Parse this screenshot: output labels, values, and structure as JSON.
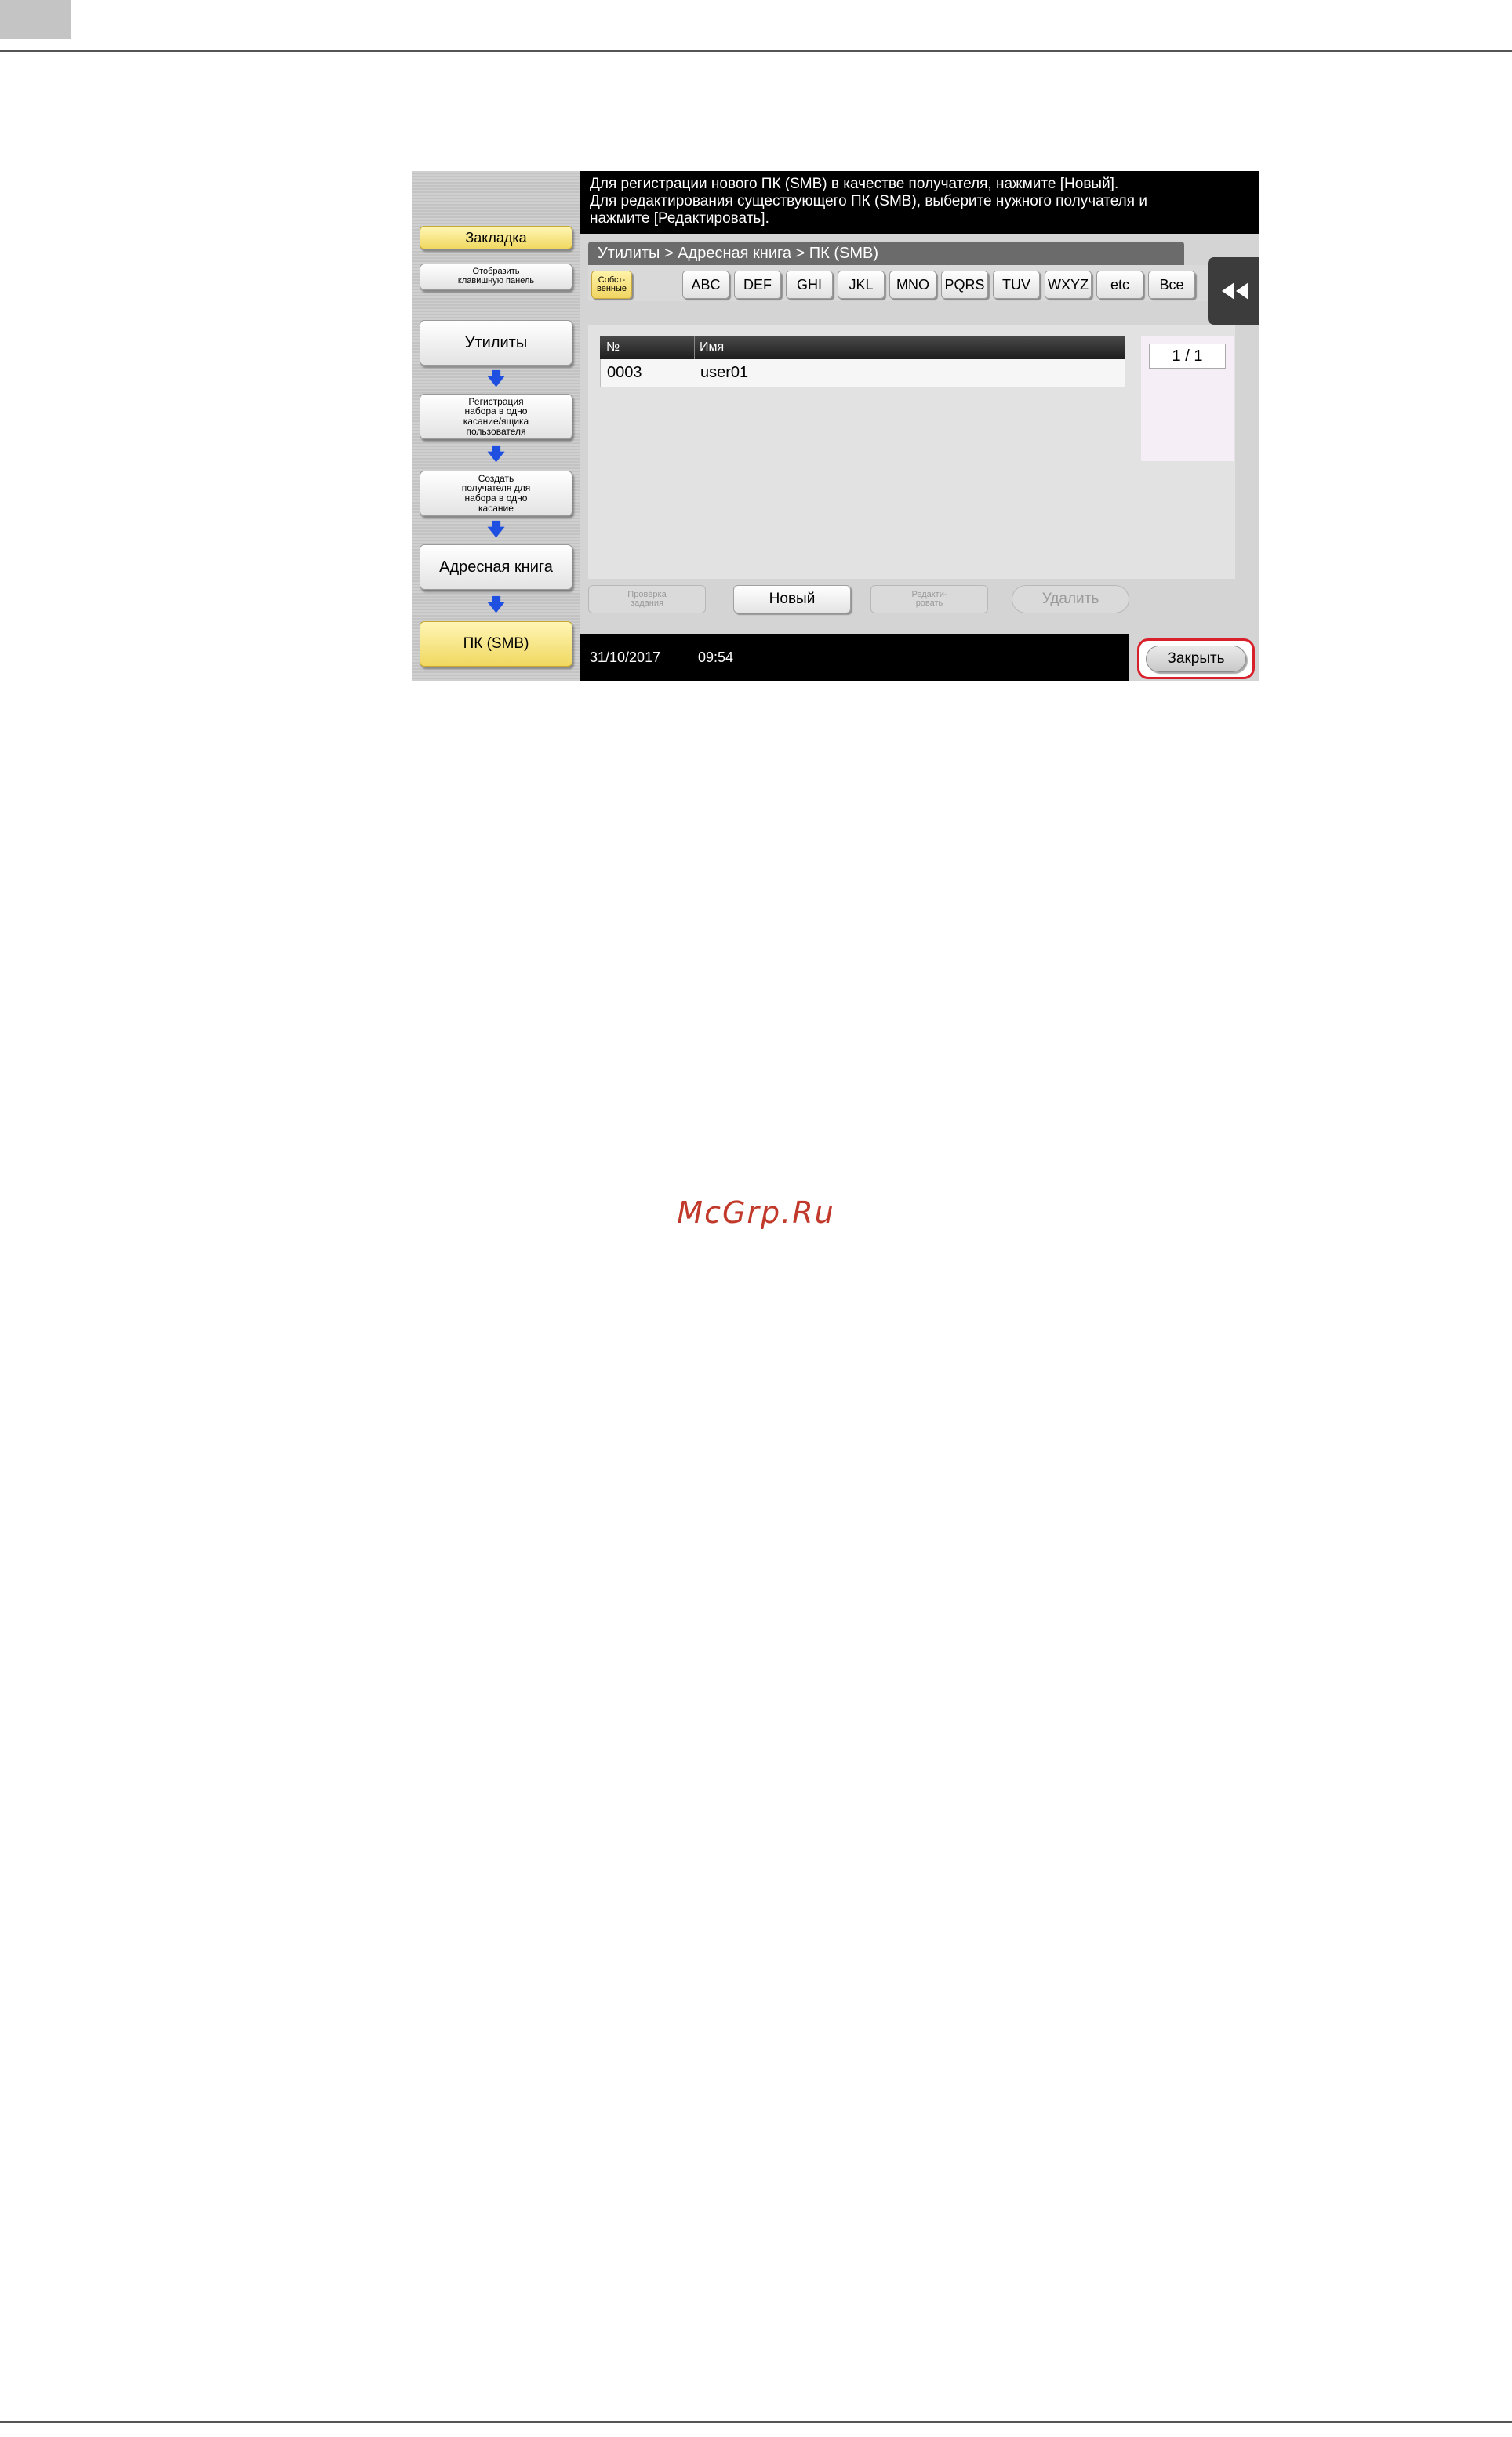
{
  "watermark": "McGrp.Ru",
  "sidebar": {
    "bookmark": "Закладка",
    "keyboard_panel_line1": "Отобразить",
    "keyboard_panel_line2": "клавишную панель",
    "items": [
      {
        "label": "Утилиты"
      },
      {
        "line1": "Регистрация",
        "line2": "набора в одно",
        "line3": "касание/ящика",
        "line4": "пользователя"
      },
      {
        "line1": "Создать",
        "line2": "получателя для",
        "line3": "набора в одно",
        "line4": "касание"
      },
      {
        "label": "Адресная книга"
      },
      {
        "label": "ПК (SMB)"
      }
    ],
    "arrow_glyph": "🡇"
  },
  "message": {
    "line1": "Для регистрации нового ПК (SMB) в качестве получателя, нажмите [Новый].",
    "line2": "Для редактирования существующего ПК (SMB), выберите нужного получателя и",
    "line3": "нажмите [Редактировать]."
  },
  "breadcrumb": "Утилиты > Адресная книга > ПК (SMB)",
  "filter_tabs": {
    "active_line1": "Собст-",
    "active_line2": "венные",
    "items": [
      "ABC",
      "DEF",
      "GHI",
      "JKL",
      "MNO",
      "PQRS",
      "TUV",
      "WXYZ",
      "etc",
      "Все"
    ]
  },
  "table": {
    "col_no": "№",
    "col_name": "Имя",
    "rows": [
      {
        "no": "0003",
        "name": "user01"
      }
    ]
  },
  "pager": {
    "text": "1 / 1"
  },
  "actions": {
    "check_line1": "Провéрка",
    "check_line2": "задания",
    "new": "Новый",
    "edit_line1": "Редакти-",
    "edit_line2": "ровать",
    "delete": "Удалить"
  },
  "status": {
    "date": "31/10/2017",
    "time": "09:54"
  },
  "close_label": "Закрыть",
  "colors": {
    "highlight_ring": "#d8202b",
    "arrow": "#1f4fe0",
    "active_tab": "#f1d562"
  }
}
